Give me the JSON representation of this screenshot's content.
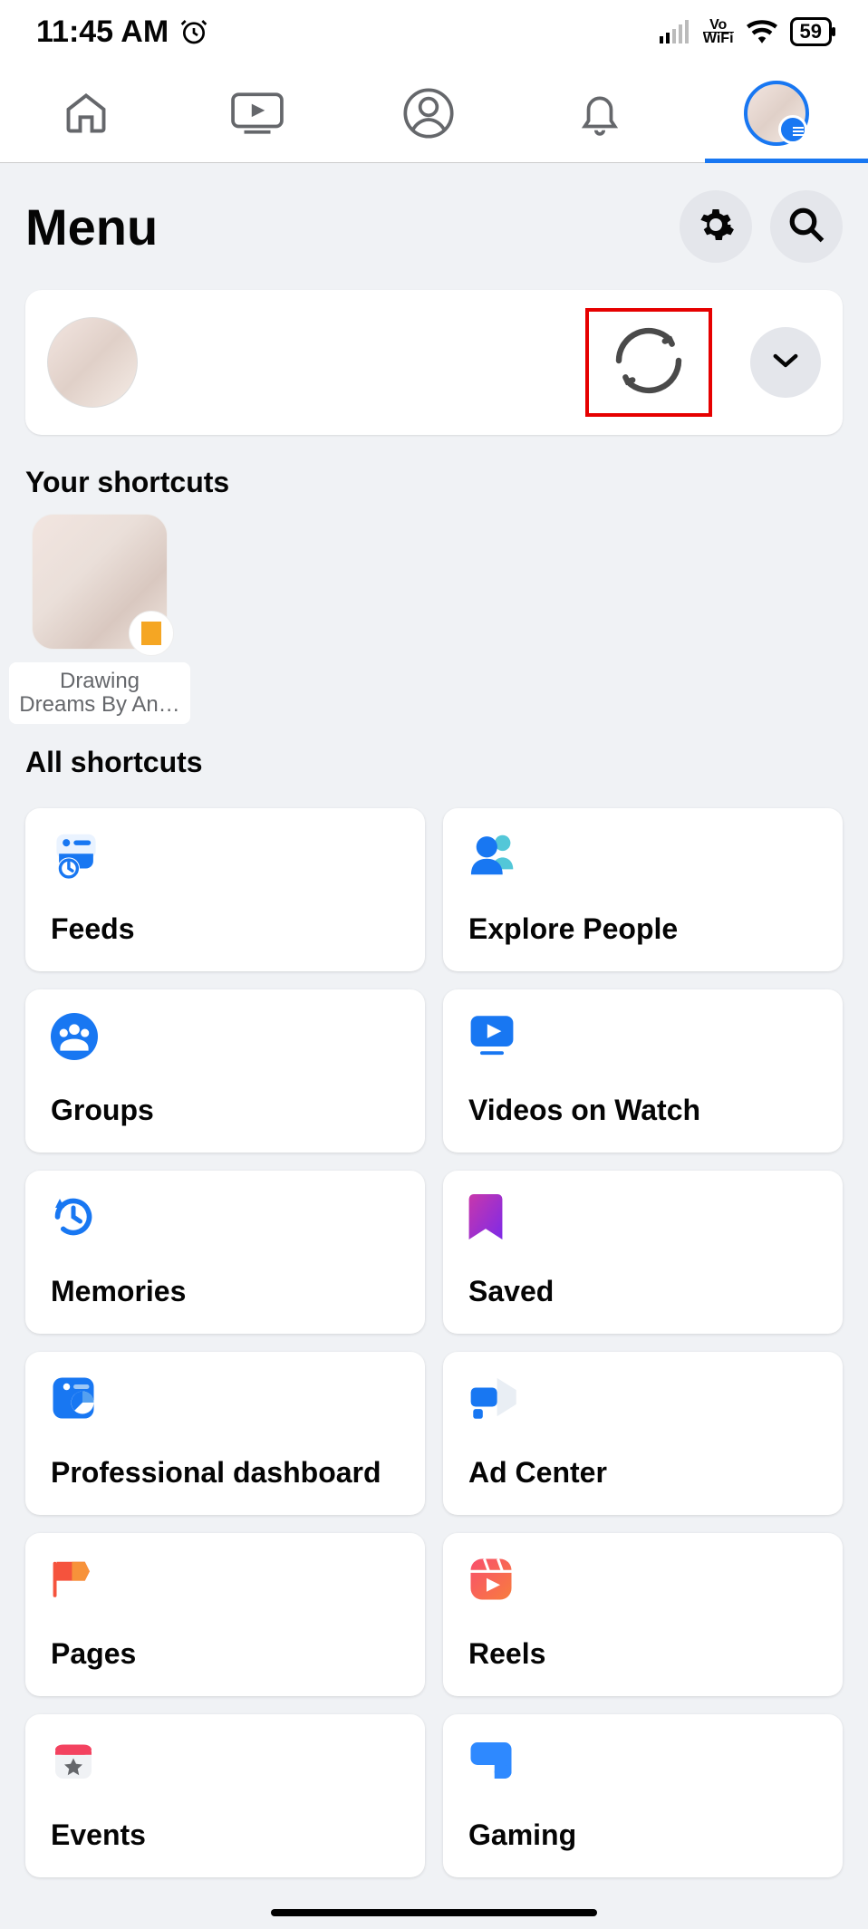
{
  "status": {
    "time": "11:45 AM",
    "battery": "59",
    "network_label": "Vo",
    "network_sub": "WiFi"
  },
  "header": {
    "title": "Menu"
  },
  "sections": {
    "your_shortcuts": "Your shortcuts",
    "all_shortcuts": "All shortcuts"
  },
  "shortcut": {
    "line1": "Drawing",
    "line2": "Dreams By An…"
  },
  "grid": {
    "feeds": "Feeds",
    "explore_people": "Explore People",
    "groups": "Groups",
    "videos_watch": "Videos on Watch",
    "memories": "Memories",
    "saved": "Saved",
    "pro_dash": "Professional dashboard",
    "ad_center": "Ad Center",
    "pages": "Pages",
    "reels": "Reels",
    "events": "Events",
    "gaming": "Gaming"
  }
}
